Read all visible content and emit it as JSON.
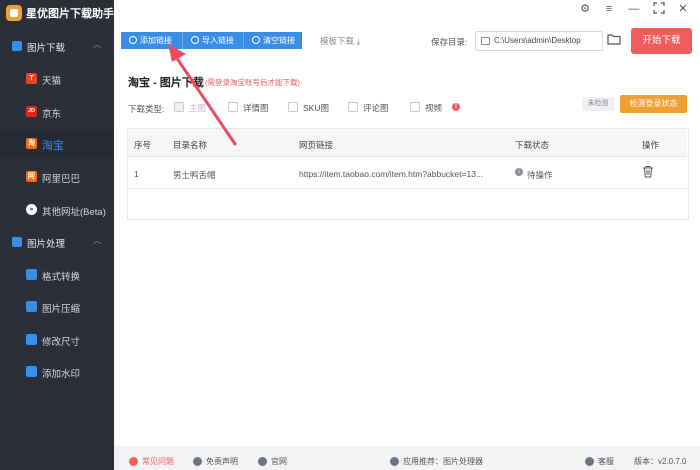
{
  "app": {
    "title": "星优图片下载助手"
  },
  "window_controls": [
    "settings-icon",
    "menu-icon",
    "minimize-icon",
    "maximize-icon",
    "close-icon"
  ],
  "sidebar": {
    "groups": [
      {
        "label": "图片下载",
        "icon": "image-download-icon",
        "expanded": true
      },
      {
        "label": "图片处理",
        "icon": "image-process-icon",
        "expanded": true
      }
    ],
    "download_items": [
      {
        "label": "天猫",
        "badge": "T",
        "color": "#e8412c"
      },
      {
        "label": "京东",
        "badge": "JD",
        "color": "#e1251b"
      },
      {
        "label": "淘宝",
        "badge": "淘",
        "color": "#ff6a00",
        "active": true
      },
      {
        "label": "阿里巴巴",
        "badge": "阿",
        "color": "#ff6a00"
      },
      {
        "label": "其他网址(Beta)",
        "badge": "●",
        "color": "#4a90e2"
      }
    ],
    "process_items": [
      {
        "label": "格式转换",
        "color": "#3a8ee6"
      },
      {
        "label": "图片压缩",
        "color": "#3a8ee6"
      },
      {
        "label": "修改尺寸",
        "color": "#3a8ee6"
      },
      {
        "label": "添加水印",
        "color": "#3a8ee6"
      }
    ]
  },
  "toolbar": {
    "add_link": "添加链接",
    "import_link": "导入链接",
    "clear_link": "清空链接",
    "template_download": "模板下载",
    "save_dir_label": "保存目录:",
    "save_dir_value": "C:\\Users\\admin\\Desktop",
    "start_button": "开始下载"
  },
  "content": {
    "title": "淘宝 - 图片下载",
    "hint": "(需登录淘宝账号后才能下载)",
    "download_type_label": "下载类型:",
    "options": [
      {
        "label": "主图",
        "checked": true,
        "disabled": true
      },
      {
        "label": "详情图",
        "checked": false
      },
      {
        "label": "SKU图",
        "checked": false
      },
      {
        "label": "评论图",
        "checked": false
      },
      {
        "label": "视频",
        "checked": false
      }
    ],
    "status_unchecked": "未检测",
    "detect_button": "检测登录状态"
  },
  "table": {
    "headers": [
      "序号",
      "目录名称",
      "网页链接",
      "下载状态",
      "操作"
    ],
    "rows": [
      {
        "index": "1",
        "name": "男士鸭舌帽",
        "url": "https://item.taobao.com/item.htm?abbucket=13...",
        "status": "待操作"
      }
    ]
  },
  "footer": {
    "faq": "常见问题",
    "disclaimer": "免责声明",
    "website": "官网",
    "recommend": "应用推荐：图片处理器",
    "support": "客服",
    "version": "版本：v2.0.7.0"
  },
  "colors": {
    "accent": "#3a8ee6",
    "danger": "#f35c5c",
    "warning": "#f0a030",
    "sidebar": "#2b2f3a"
  }
}
